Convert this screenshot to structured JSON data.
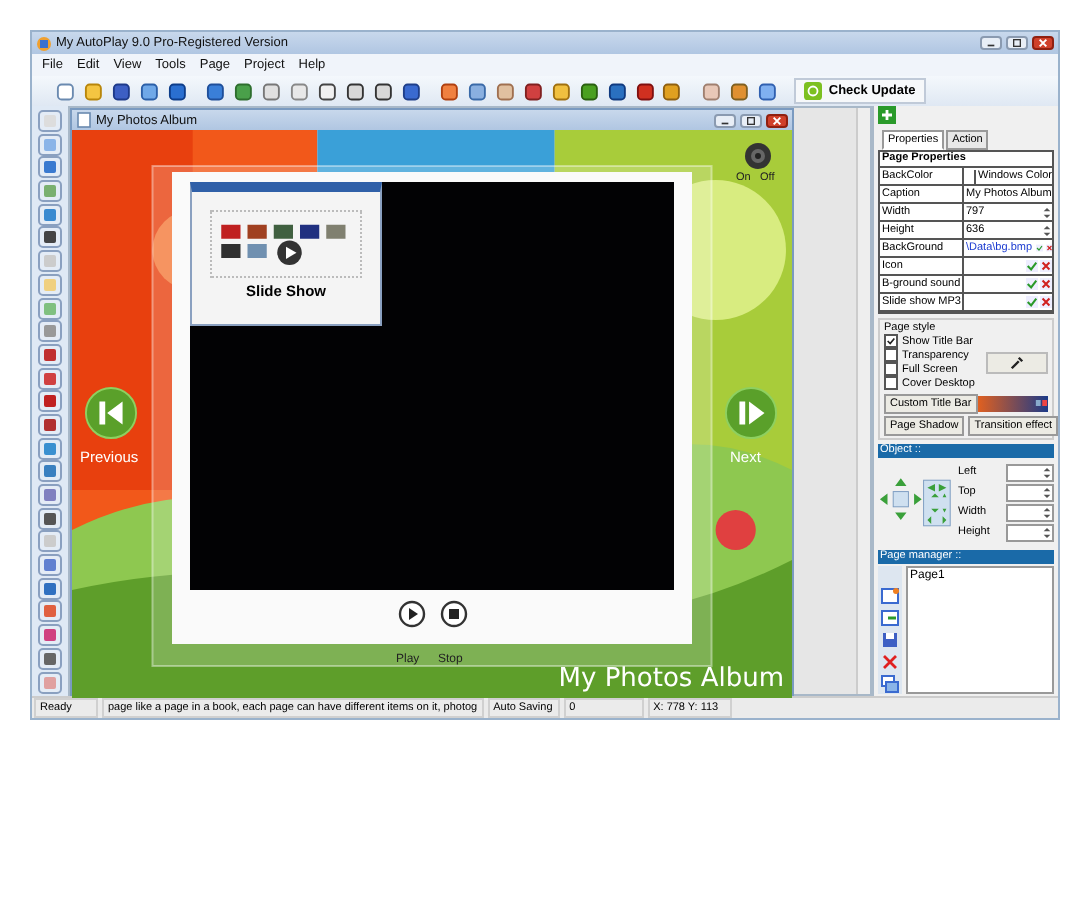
{
  "window": {
    "title": "My AutoPlay 9.0 Pro-Registered Version"
  },
  "menu": [
    "File",
    "Edit",
    "View",
    "Tools",
    "Page",
    "Project",
    "Help"
  ],
  "toolbar": {
    "check_update": "Check Update"
  },
  "document": {
    "title": "My Photos Album",
    "sound_on": "On",
    "sound_off": "Off",
    "previous": "Previous",
    "next": "Next",
    "thumbnail_caption": "Slide Show",
    "play": "Play",
    "stop": "Stop",
    "album_title": "My Photos Album"
  },
  "properties": {
    "tabs": [
      {
        "label": "Properties",
        "selected": true
      },
      {
        "label": "Action",
        "selected": false
      }
    ],
    "heading": "Page Properties",
    "rows": [
      {
        "kind": "color",
        "label": "BackColor",
        "value": "Windows Color"
      },
      {
        "kind": "text",
        "label": "Caption",
        "value": "My Photos Album"
      },
      {
        "kind": "spin",
        "label": "Width",
        "value": "797"
      },
      {
        "kind": "spin",
        "label": "Height",
        "value": "636"
      },
      {
        "kind": "file",
        "label": "BackGround",
        "value": "\\Data\\bg.bmp"
      },
      {
        "kind": "file",
        "label": "Icon"
      },
      {
        "kind": "file",
        "label": "B-ground sound"
      },
      {
        "kind": "file",
        "label": "Slide show MP3"
      }
    ]
  },
  "page_style": {
    "title": "Page style",
    "options": [
      {
        "label": "Show Title Bar",
        "checked": true
      },
      {
        "label": "Transparency",
        "checked": false
      },
      {
        "label": "Full Screen",
        "checked": false
      },
      {
        "label": "Cover Desktop",
        "checked": false
      }
    ],
    "custom_title_bar": "Custom Title Bar",
    "page_shadow": "Page Shadow",
    "transition_effect": "Transition effect"
  },
  "object": {
    "title": "Object ::",
    "fields": [
      "Left",
      "Top",
      "Width",
      "Height"
    ]
  },
  "page_manager": {
    "title": "Page manager ::",
    "pages": [
      "Page1"
    ]
  },
  "status_bar": [
    "Ready",
    "page like a page in a book, each page can have different items on it, photog",
    "Auto Saving",
    "0",
    "X: 778 Y: 113"
  ]
}
